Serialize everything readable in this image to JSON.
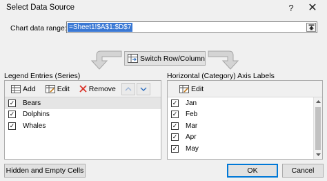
{
  "window": {
    "title": "Select Data Source",
    "help": "?",
    "close": "✕"
  },
  "range": {
    "label": "Chart data range:",
    "value": "=Sheet1!$A$1:$D$7"
  },
  "switch_label": "Switch Row/Column",
  "series_pane": {
    "label": "Legend Entries (Series)",
    "add": "Add",
    "edit": "Edit",
    "remove": "Remove",
    "items": [
      {
        "label": "Bears",
        "checked": true,
        "selected": true
      },
      {
        "label": "Dolphins",
        "checked": true,
        "selected": false
      },
      {
        "label": "Whales",
        "checked": true,
        "selected": false
      }
    ]
  },
  "axis_pane": {
    "label": "Horizontal (Category) Axis Labels",
    "edit": "Edit",
    "items": [
      {
        "label": "Jan",
        "checked": true
      },
      {
        "label": "Feb",
        "checked": true
      },
      {
        "label": "Mar",
        "checked": true
      },
      {
        "label": "Apr",
        "checked": true
      },
      {
        "label": "May",
        "checked": true
      }
    ]
  },
  "buttons": {
    "hidden_empty": "Hidden and Empty Cells",
    "ok": "OK",
    "cancel": "Cancel"
  },
  "colors": {
    "selection": "#3a78d4",
    "remove_red": "#d9342b",
    "ok_border": "#0078d7"
  }
}
